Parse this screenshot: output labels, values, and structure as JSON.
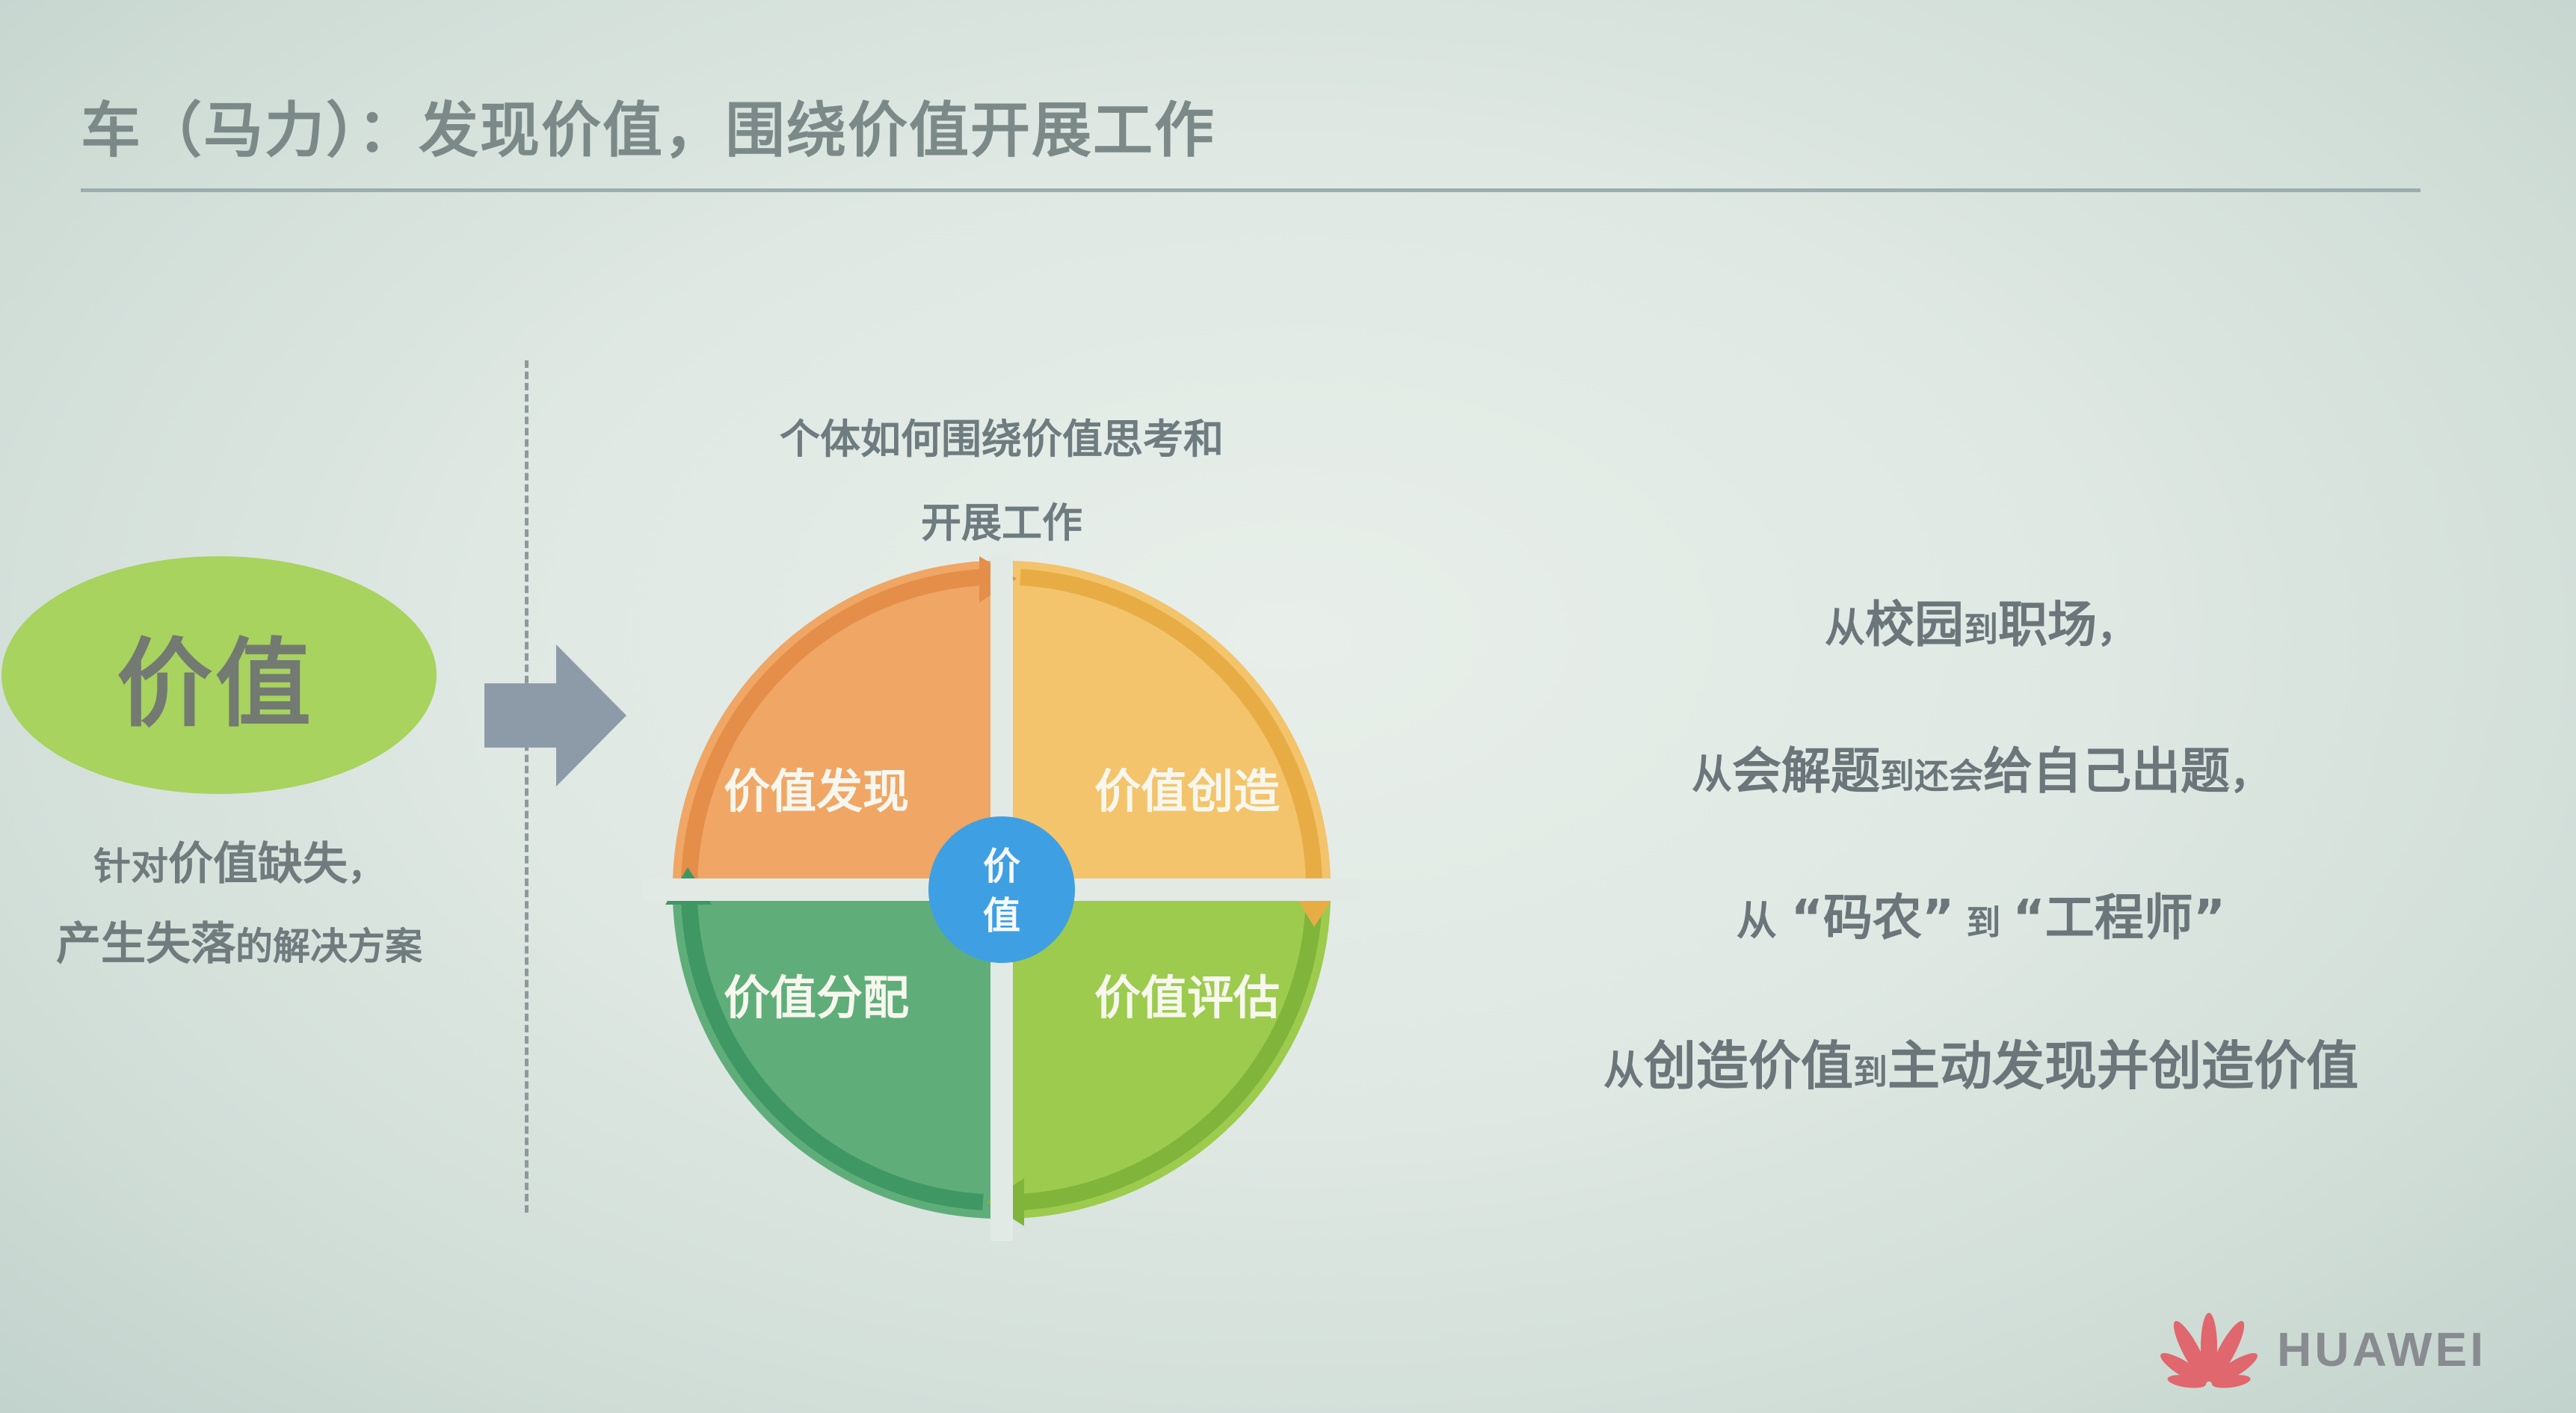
{
  "title": "车（马力）：发现价值，围绕价值开展工作",
  "left_panel": {
    "value_label": "价值",
    "desc_line1_prefix": "针对",
    "desc_line1_strong": "价值缺失",
    "desc_line1_suffix": "，",
    "desc_line2_strong": "产生失落",
    "desc_line2_suffix": "的解决方案"
  },
  "diagram": {
    "caption_line1": "个体如何围绕价值思考和",
    "caption_line2": "开展工作",
    "center_label_1": "价",
    "center_label_2": "值",
    "quadrants": [
      {
        "label": "价值发现",
        "color": "#f0a665"
      },
      {
        "label": "价值创造",
        "color": "#f3c46b"
      },
      {
        "label": "价值分配",
        "color": "#5fae7a"
      },
      {
        "label": "价值评估",
        "color": "#9ccb4e"
      }
    ],
    "center_color": "#3f9fe3"
  },
  "statements": [
    {
      "p1": "从",
      "s1": "校园",
      "p2": "到",
      "s2": "职场",
      "p3": "，"
    },
    {
      "p1": "从",
      "s1": "会解题",
      "p2": "到还会",
      "s2": "给自己出题",
      "p3": "，"
    },
    {
      "p1": "从 ",
      "s1": "“码农”",
      "p2": " 到 ",
      "s2": "“工程师”",
      "p3": ""
    },
    {
      "p1": "从",
      "s1": "创造价值",
      "p2": "到",
      "s2": "主动发现并创造价值",
      "p3": ""
    }
  ],
  "logo": {
    "text": "HUAWEI",
    "icon": "huawei-petal-icon"
  }
}
